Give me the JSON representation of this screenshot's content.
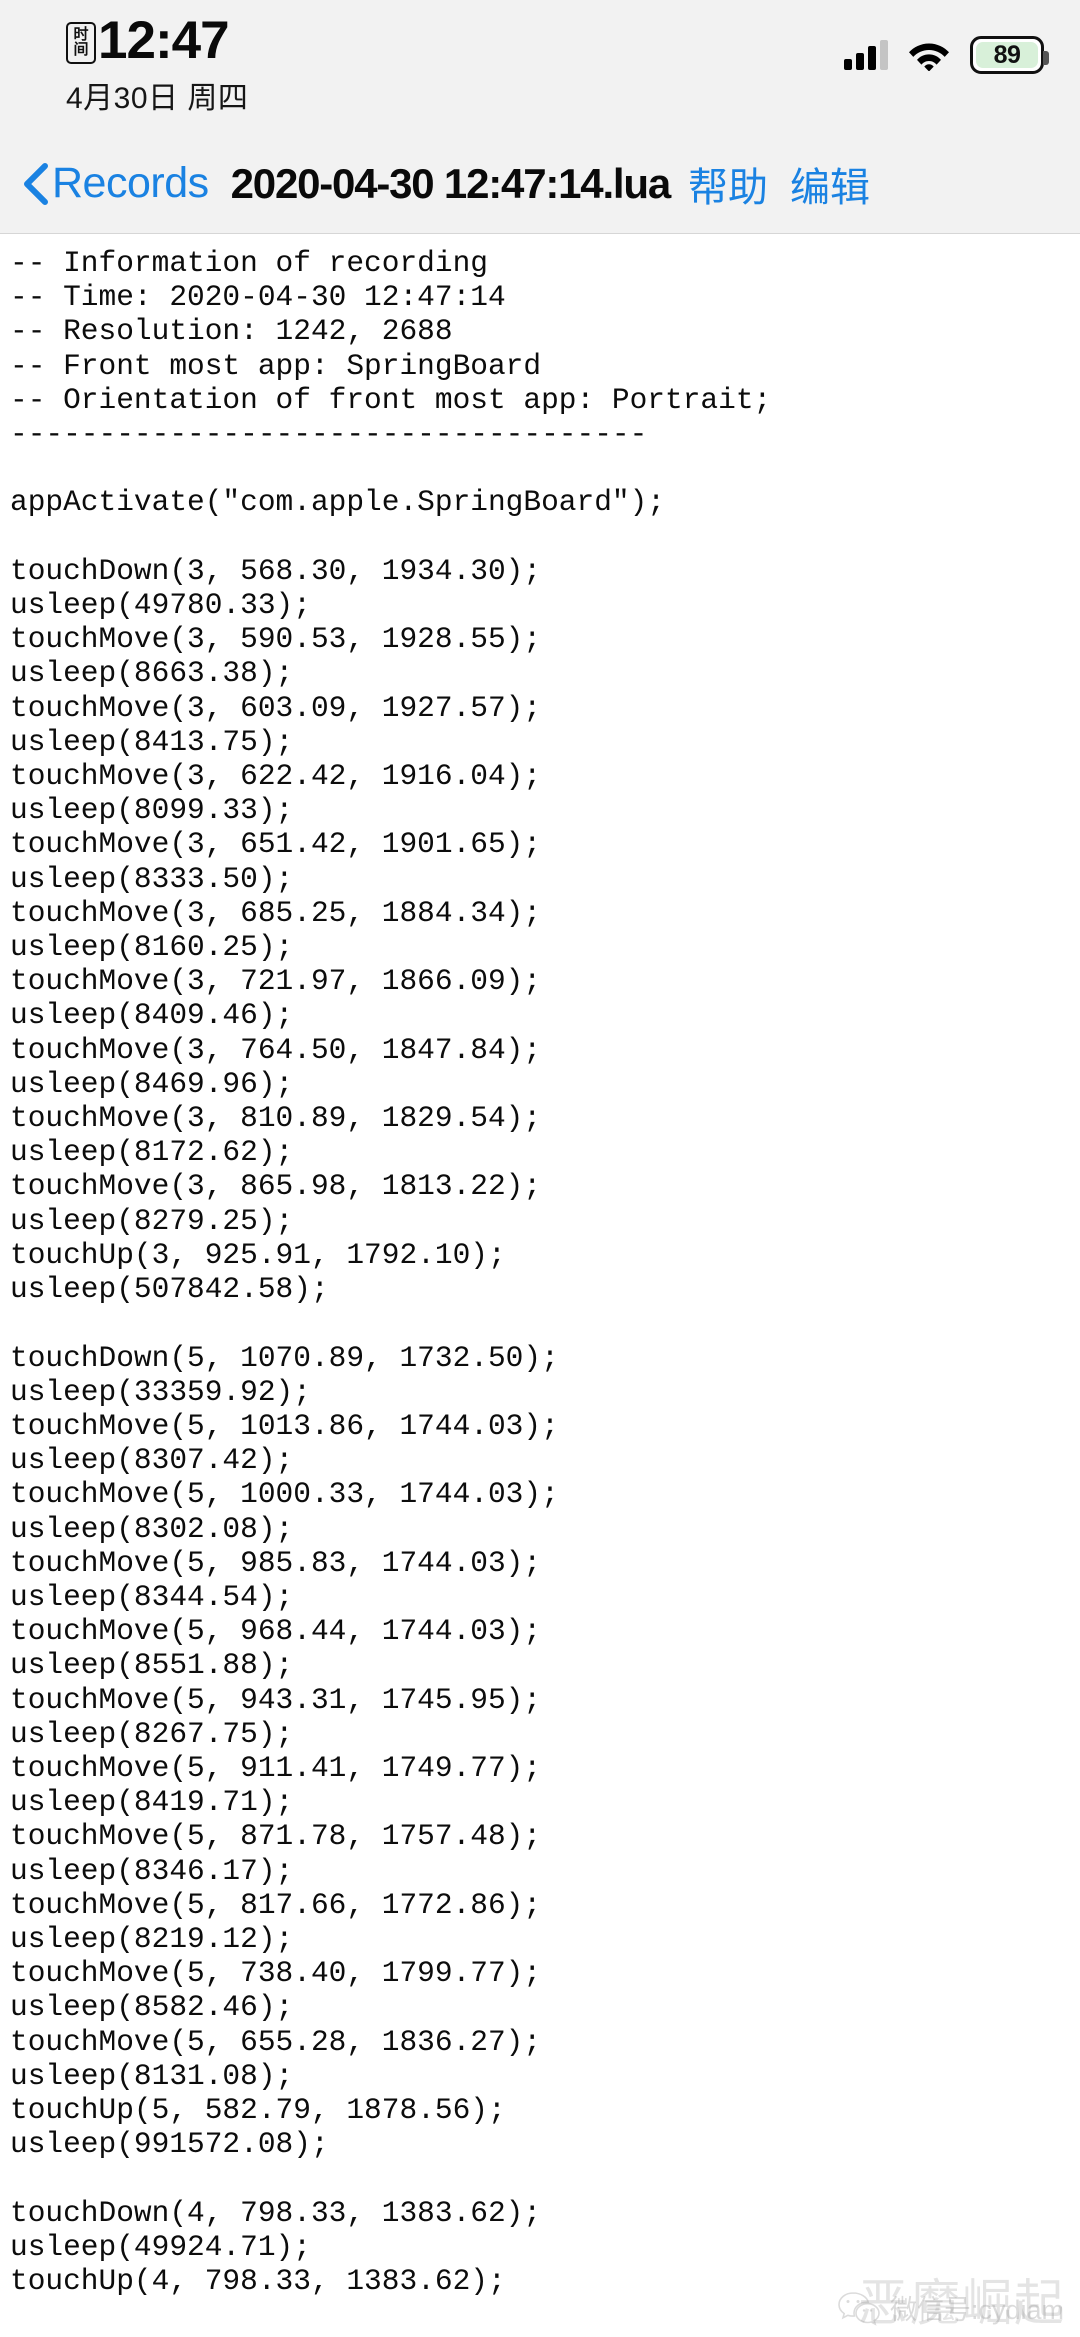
{
  "status_bar": {
    "time_badge_top": "时",
    "time_badge_bottom": "间",
    "time": "12:47",
    "date": "4月30日 周四",
    "battery_level": "89",
    "battery_color": "#d8f0d9",
    "signal_icon": "cellular-signal-icon",
    "wifi_icon": "wifi-icon"
  },
  "nav": {
    "back_label": "Records",
    "title": "2020-04-30 12:47:14.lua",
    "help_label": "帮助",
    "edit_label": "编辑",
    "accent_color": "#1a82e2"
  },
  "editor": {
    "content": "-- Information of recording\n-- Time: 2020-04-30 12:47:14\n-- Resolution: 1242, 2688\n-- Front most app: SpringBoard\n-- Orientation of front most app: Portrait;\n------------------------------------\n\nappActivate(\"com.apple.SpringBoard\");\n\ntouchDown(3, 568.30, 1934.30);\nusleep(49780.33);\ntouchMove(3, 590.53, 1928.55);\nusleep(8663.38);\ntouchMove(3, 603.09, 1927.57);\nusleep(8413.75);\ntouchMove(3, 622.42, 1916.04);\nusleep(8099.33);\ntouchMove(3, 651.42, 1901.65);\nusleep(8333.50);\ntouchMove(3, 685.25, 1884.34);\nusleep(8160.25);\ntouchMove(3, 721.97, 1866.09);\nusleep(8409.46);\ntouchMove(3, 764.50, 1847.84);\nusleep(8469.96);\ntouchMove(3, 810.89, 1829.54);\nusleep(8172.62);\ntouchMove(3, 865.98, 1813.22);\nusleep(8279.25);\ntouchUp(3, 925.91, 1792.10);\nusleep(507842.58);\n\ntouchDown(5, 1070.89, 1732.50);\nusleep(33359.92);\ntouchMove(5, 1013.86, 1744.03);\nusleep(8307.42);\ntouchMove(5, 1000.33, 1744.03);\nusleep(8302.08);\ntouchMove(5, 985.83, 1744.03);\nusleep(8344.54);\ntouchMove(5, 968.44, 1744.03);\nusleep(8551.88);\ntouchMove(5, 943.31, 1745.95);\nusleep(8267.75);\ntouchMove(5, 911.41, 1749.77);\nusleep(8419.71);\ntouchMove(5, 871.78, 1757.48);\nusleep(8346.17);\ntouchMove(5, 817.66, 1772.86);\nusleep(8219.12);\ntouchMove(5, 738.40, 1799.77);\nusleep(8582.46);\ntouchMove(5, 655.28, 1836.27);\nusleep(8131.08);\ntouchUp(5, 582.79, 1878.56);\nusleep(991572.08);\n\ntouchDown(4, 798.33, 1383.62);\nusleep(49924.71);\ntouchUp(4, 798.33, 1383.62);"
  },
  "watermark": {
    "text": "微信号:cydiam",
    "ghost_text": "恶魔崛起",
    "icon": "wechat-icon"
  }
}
